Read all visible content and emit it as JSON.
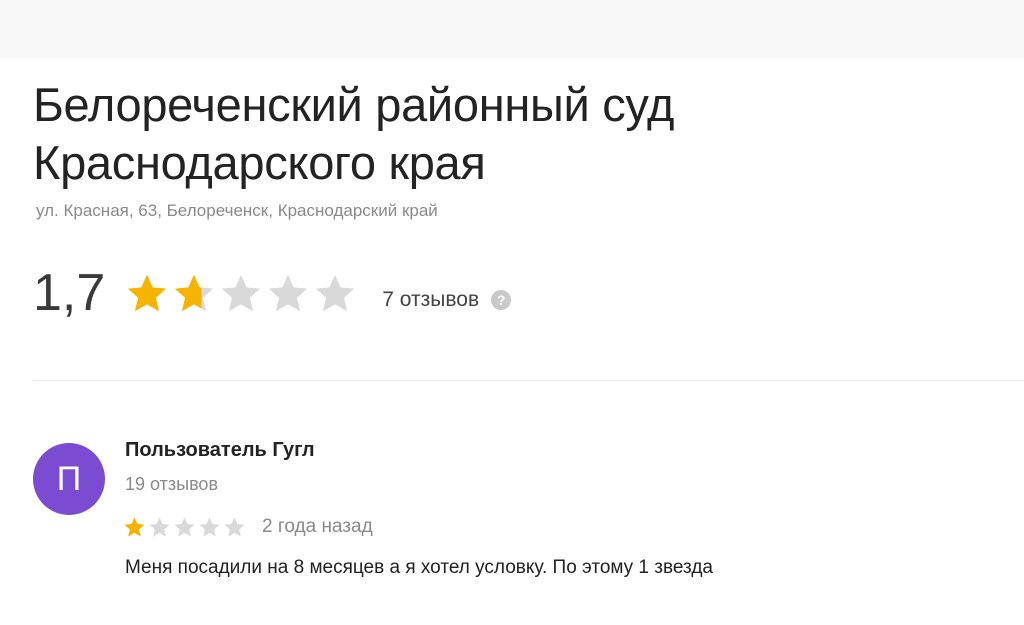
{
  "place": {
    "title": "Белореченский районный суд Краснодарского края",
    "address": "ул. Красная, 63, Белореченск, Краснодарский край"
  },
  "rating": {
    "value_text": "1,7",
    "value": 1.7,
    "max": 5,
    "review_count_text": "7 отзывов",
    "help_icon_glyph": "?"
  },
  "review": {
    "avatar_letter": "П",
    "avatar_color": "#7b4cd1",
    "author": "Пользователь Гугл",
    "author_reviews_text": "19 отзывов",
    "stars": 1,
    "date_text": "2 года назад",
    "text": "Меня посадили на 8 месяцев а я хотел условку. По этому 1 звезда"
  },
  "colors": {
    "star_filled": "#f6b400",
    "star_empty": "#d9d9d9"
  },
  "icons": {
    "star": "star-icon",
    "help": "help-icon"
  }
}
